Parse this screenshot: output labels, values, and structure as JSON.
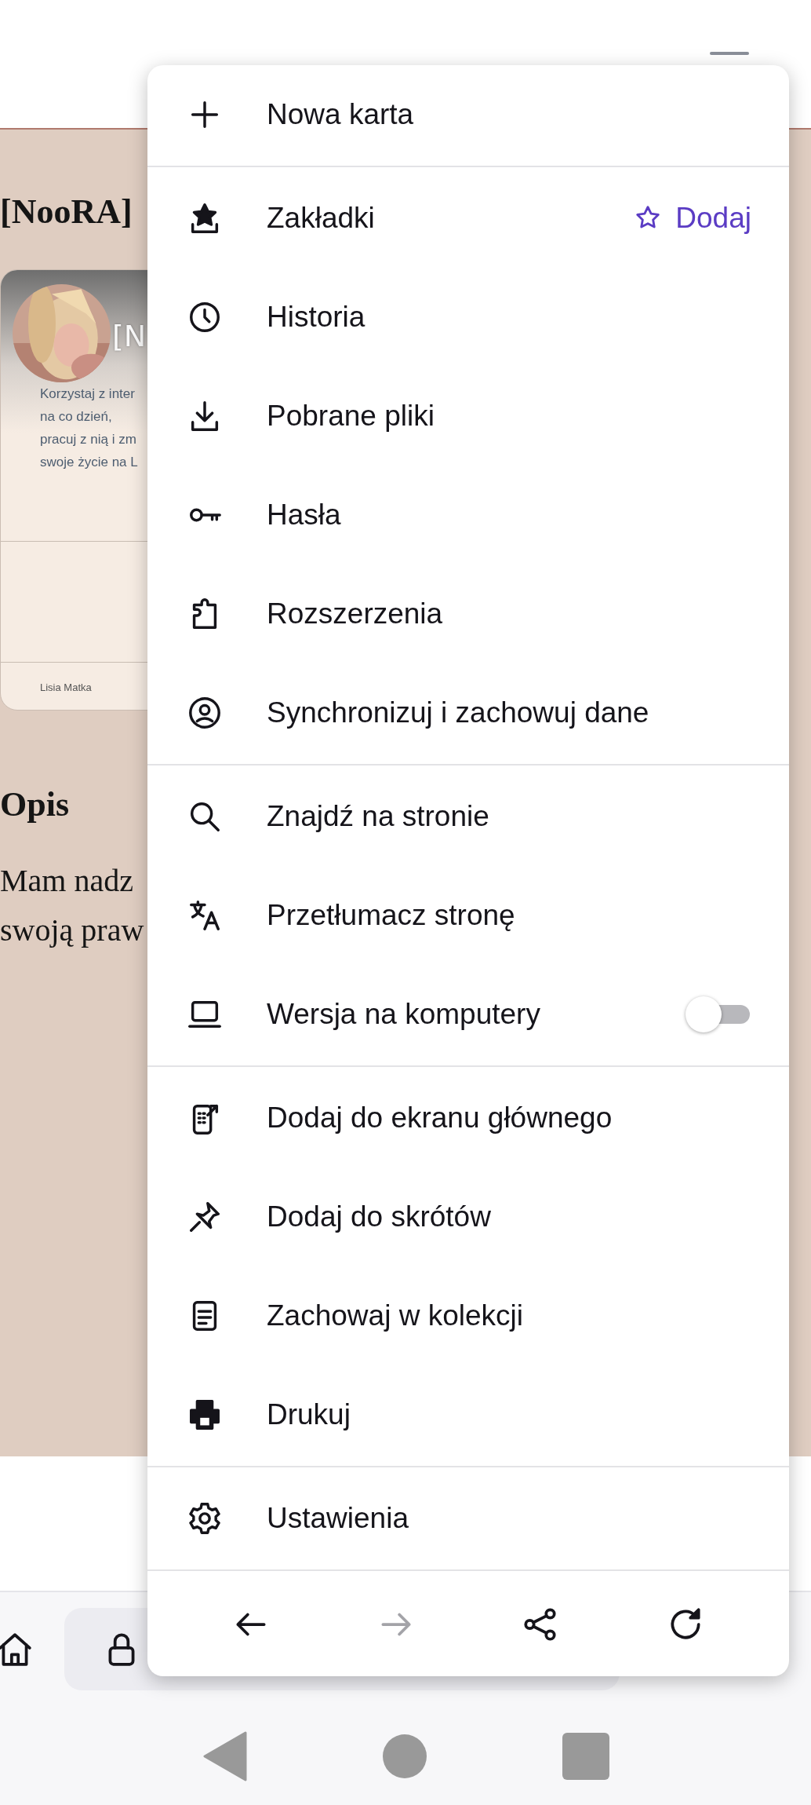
{
  "page": {
    "title": "[NooRA]",
    "card": {
      "heading": "[N",
      "lines": [
        "Korzystaj z inter",
        "na co dzień,",
        "pracuj z nią i zm",
        "swoje życie na L"
      ],
      "author": "Lisia Matka"
    },
    "section_heading": "Opis",
    "paragraph_lines": [
      "Mam nadz",
      "swoją praw"
    ]
  },
  "menu": {
    "groups": [
      {
        "items": [
          {
            "kind": "item",
            "label": "Nowa karta"
          }
        ]
      },
      {
        "items": [
          {
            "kind": "item",
            "label": "Zakładki",
            "action": "Dodaj"
          },
          {
            "kind": "item",
            "label": "Historia"
          },
          {
            "kind": "item",
            "label": "Pobrane pliki"
          },
          {
            "kind": "item",
            "label": "Hasła"
          },
          {
            "kind": "item",
            "label": "Rozszerzenia"
          },
          {
            "kind": "item",
            "label": "Synchronizuj i zachowuj dane"
          }
        ]
      },
      {
        "items": [
          {
            "kind": "item",
            "label": "Znajdź na stronie"
          },
          {
            "kind": "item",
            "label": "Przetłumacz stronę"
          },
          {
            "kind": "toggle",
            "label": "Wersja na komputery",
            "on": false
          }
        ]
      },
      {
        "items": [
          {
            "kind": "item",
            "label": "Dodaj do ekranu głównego"
          },
          {
            "kind": "item",
            "label": "Dodaj do skrótów"
          },
          {
            "kind": "item",
            "label": "Zachowaj w kolekcji"
          },
          {
            "kind": "item",
            "label": "Drukuj"
          }
        ]
      },
      {
        "items": [
          {
            "kind": "item",
            "label": "Ustawienia"
          }
        ]
      }
    ],
    "nav": [
      {
        "disabled": false
      },
      {
        "disabled": true
      },
      {
        "disabled": false
      },
      {
        "disabled": false
      }
    ]
  }
}
